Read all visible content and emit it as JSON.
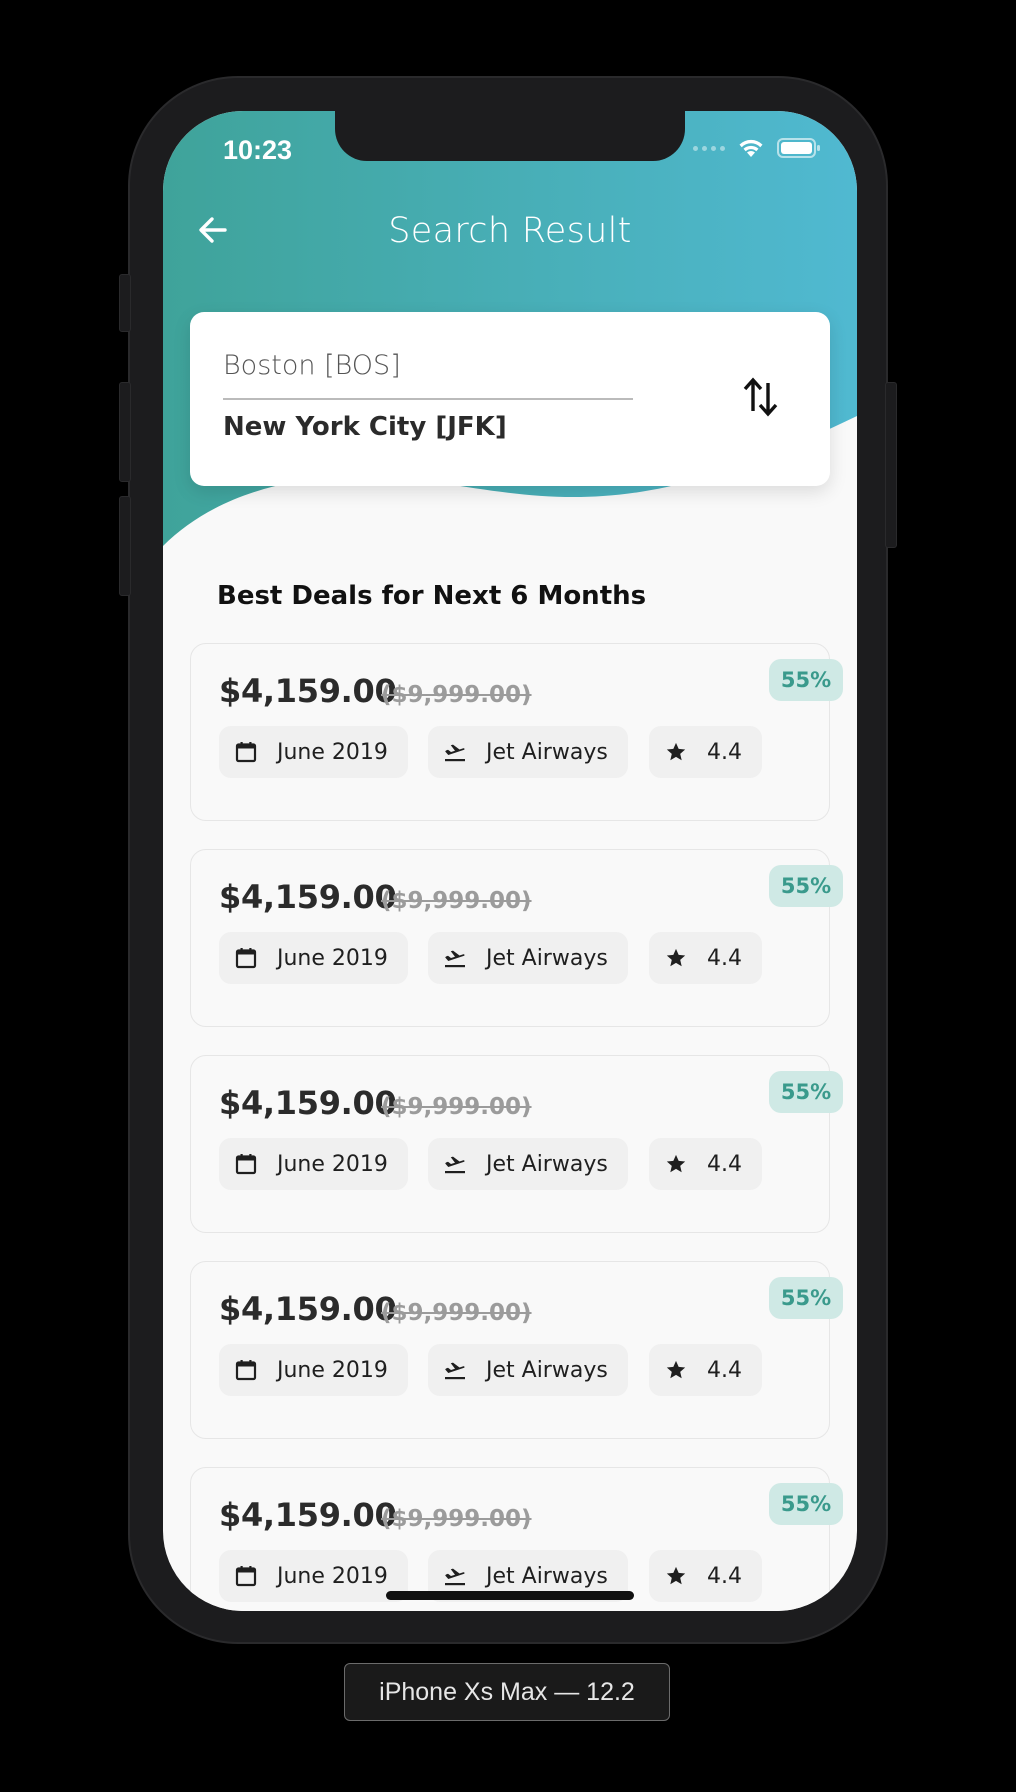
{
  "status_bar": {
    "time": "10:23",
    "icons": [
      "signal-dots-icon",
      "wifi-icon",
      "battery-icon"
    ]
  },
  "header": {
    "title": "Search Result",
    "back_icon": "arrow-left-icon",
    "gradient": [
      "#3fa39a",
      "#50b9d1"
    ]
  },
  "route": {
    "from": "Boston [BOS]",
    "to": "New York City [JFK]",
    "swap_icon": "swap-vertical-icon"
  },
  "deals_section": {
    "title": "Best Deals for Next 6 Months",
    "items": [
      {
        "price": "$4,159.00",
        "old_price": "($9,999.00)",
        "discount": "55%",
        "date": "June 2019",
        "airline": "Jet Airways",
        "rating": "4.4"
      },
      {
        "price": "$4,159.00",
        "old_price": "($9,999.00)",
        "discount": "55%",
        "date": "June 2019",
        "airline": "Jet Airways",
        "rating": "4.4"
      },
      {
        "price": "$4,159.00",
        "old_price": "($9,999.00)",
        "discount": "55%",
        "date": "June 2019",
        "airline": "Jet Airways",
        "rating": "4.4"
      },
      {
        "price": "$4,159.00",
        "old_price": "($9,999.00)",
        "discount": "55%",
        "date": "June 2019",
        "airline": "Jet Airways",
        "rating": "4.4"
      },
      {
        "price": "$4,159.00",
        "old_price": "($9,999.00)",
        "discount": "55%",
        "date": "June 2019",
        "airline": "Jet Airways",
        "rating": "4.4"
      }
    ]
  },
  "colors": {
    "accent": "#3a9a8c",
    "badge_bg": "#cfe9e5"
  },
  "device_label": "iPhone Xs Max — 12.2"
}
